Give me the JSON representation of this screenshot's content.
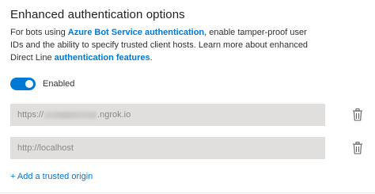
{
  "section": {
    "title": "Enhanced authentication options",
    "description": {
      "line1_prefix": "For bots using ",
      "line1_link": "Azure Bot Service authentication",
      "line1_suffix": ", enable tamper-proof user",
      "line2": "IDs and the ability to specify trusted client hosts. Learn more about enhanced",
      "line3_prefix": "Direct Line ",
      "line3_link": "authentication features",
      "line3_suffix": "."
    }
  },
  "toggle": {
    "label": "Enabled",
    "state": "on",
    "accent_color": "#0078d4"
  },
  "trusted_origins": [
    {
      "value_prefix": "https://",
      "value_obscured": true,
      "value_suffix": ".ngrok.io",
      "delete_icon": "trash-icon"
    },
    {
      "value_prefix": "http://localhost",
      "value_obscured": false,
      "value_suffix": "",
      "delete_icon": "trash-icon"
    }
  ],
  "add_origin_label": "+ Add a trusted origin"
}
